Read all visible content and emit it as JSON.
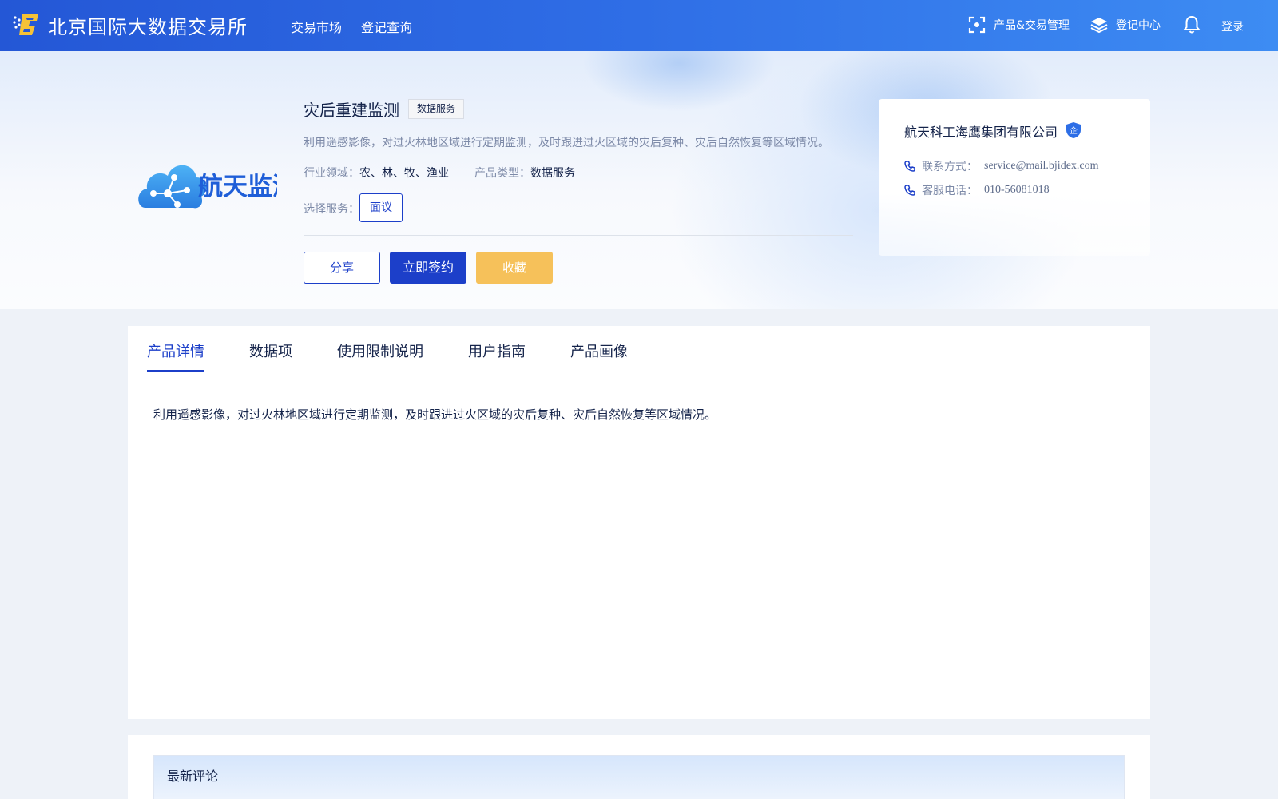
{
  "header": {
    "site_name": "北京国际大数据交易所",
    "nav": [
      "交易市场",
      "登记查询"
    ],
    "right": {
      "product_trade_mgmt": "产品&交易管理",
      "register_center": "登记中心",
      "login": "登录"
    }
  },
  "product": {
    "logo_text": "航天监测",
    "title": "灾后重建监测",
    "tag": "数据服务",
    "description": "利用遥感影像，对过火林地区域进行定期监测，及时跟进过火区域的灾后复种、灾后自然恢复等区域情况。",
    "industry_label": "行业领域：",
    "industry_value": "农、林、牧、渔业",
    "type_label": "产品类型：",
    "type_value": "数据服务",
    "service_label": "选择服务：",
    "service_option": "面议",
    "buttons": {
      "share": "分享",
      "sign": "立即签约",
      "favorite": "收藏"
    }
  },
  "company": {
    "name": "航天科工海鹰集团有限公司",
    "badge": "企",
    "contact_label": "联系方式：",
    "contact_value": "service@mail.bjidex.com",
    "phone_label": "客服电话：",
    "phone_value": "010-56081018"
  },
  "tabs": {
    "items": [
      "产品详情",
      "数据项",
      "使用限制说明",
      "用户指南",
      "产品画像"
    ],
    "active_index": 0,
    "content": "利用遥感影像，对过火林地区域进行定期监测，及时跟进过火区域的灾后复种、灾后自然恢复等区域情况。"
  },
  "comments": {
    "title": "最新评论"
  },
  "colors": {
    "primary": "#1c3fc9",
    "accent_yellow": "#f6c15a",
    "header_start": "#2457d6",
    "header_end": "#3d8cf3"
  }
}
